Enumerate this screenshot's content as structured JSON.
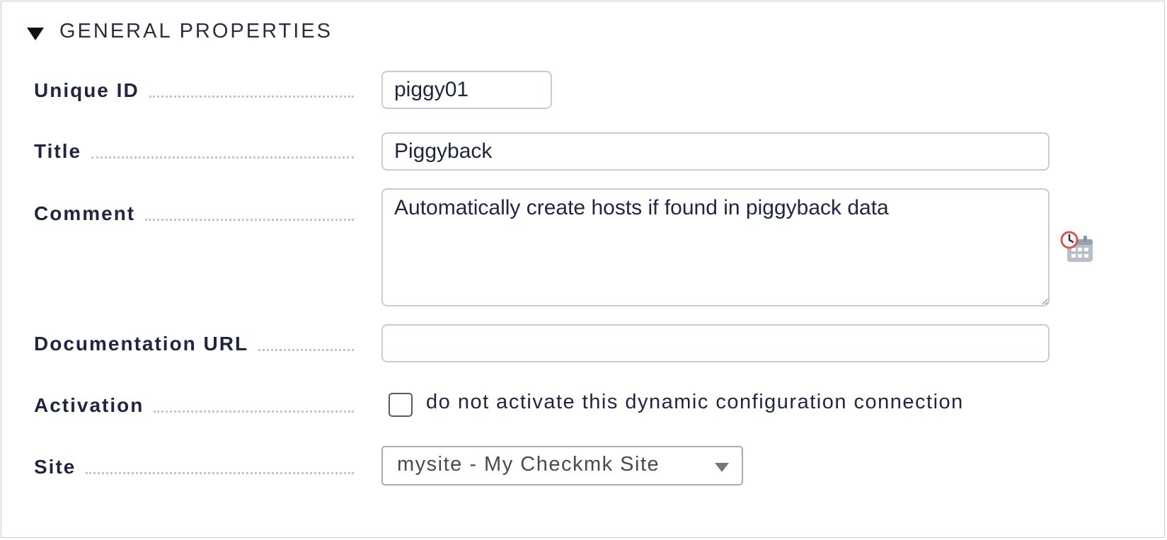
{
  "section": {
    "title": "GENERAL PROPERTIES"
  },
  "fields": {
    "unique_id": {
      "label": "Unique ID",
      "value": "piggy01"
    },
    "title": {
      "label": "Title",
      "value": "Piggyback"
    },
    "comment": {
      "label": "Comment",
      "value": "Automatically create hosts if found in piggyback data"
    },
    "documentation_url": {
      "label": "Documentation URL",
      "value": ""
    },
    "activation": {
      "label": "Activation",
      "checkbox_label": "do not activate this dynamic configuration connection",
      "checked": false
    },
    "site": {
      "label": "Site",
      "selected": "mysite - My Checkmk Site"
    }
  },
  "icons": {
    "section_toggle": "triangle-down-icon",
    "comment_addon": "calendar-clock-icon"
  },
  "colors": {
    "text": "#1e2640",
    "border": "#c9cbd4",
    "dots": "#c2c5cf",
    "clock_accent": "#e05252"
  }
}
